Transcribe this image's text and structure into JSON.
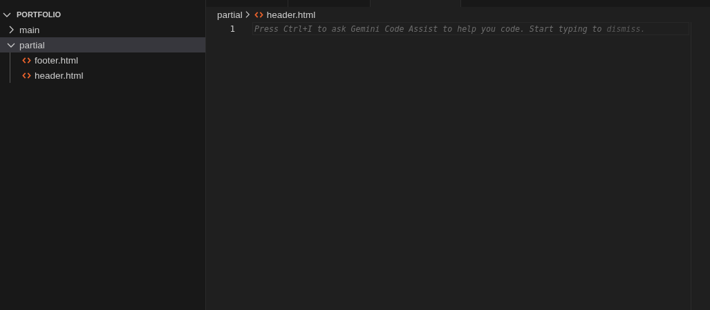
{
  "explorer": {
    "title": "PORTFOLIO",
    "expanded": true,
    "items": [
      {
        "label": "main",
        "kind": "folder",
        "expanded": false,
        "selected": false
      },
      {
        "label": "partial",
        "kind": "folder",
        "expanded": true,
        "selected": true,
        "children": [
          {
            "label": "footer.html",
            "kind": "html",
            "selected": false
          },
          {
            "label": "header.html",
            "kind": "html",
            "selected": false
          }
        ]
      }
    ]
  },
  "tabs": [
    {
      "selected": false
    },
    {
      "selected": false
    },
    {
      "selected": true
    }
  ],
  "breadcrumbs": [
    {
      "label": "partial",
      "kind": "folder"
    },
    {
      "label": "header.html",
      "kind": "html"
    }
  ],
  "editor": {
    "line_numbers": [
      "1"
    ],
    "hint": "Press Ctrl+I to ask Gemini Code Assist to help you code. Start typing to",
    "hint_faded": "dismiss."
  }
}
